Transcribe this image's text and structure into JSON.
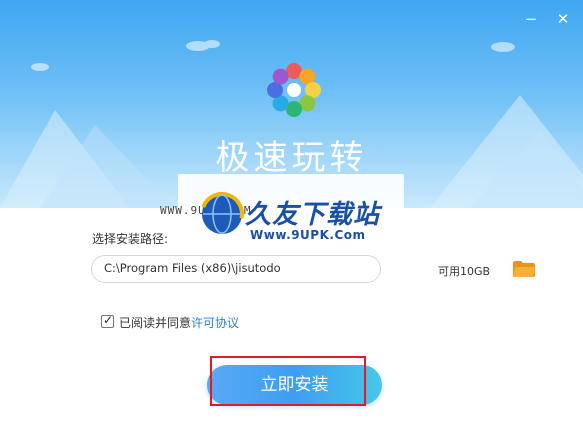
{
  "window": {
    "minimize_glyph": "−",
    "close_glyph": "✕"
  },
  "app": {
    "title": "极速玩转",
    "icon": "colorful-pinwheel-logo"
  },
  "watermark": {
    "small_text": "WWW.9UPK.COM",
    "title": "久友下载站",
    "url": "Www.9UPK.Com"
  },
  "install": {
    "path_label": "选择安装路径:",
    "path_value": "C:\\Program Files (x86)\\jisutodo",
    "space_text": "可用10GB",
    "folder_icon": "folder-icon",
    "agree_text": "已阅读并同意",
    "agree_link": "许可协议",
    "agree_checked": true,
    "button_label": "立即安装"
  },
  "colors": {
    "accent": "#3d9ef2",
    "link": "#2b7fd6",
    "highlight_box": "#e01b24",
    "folder": "#f4a623"
  }
}
